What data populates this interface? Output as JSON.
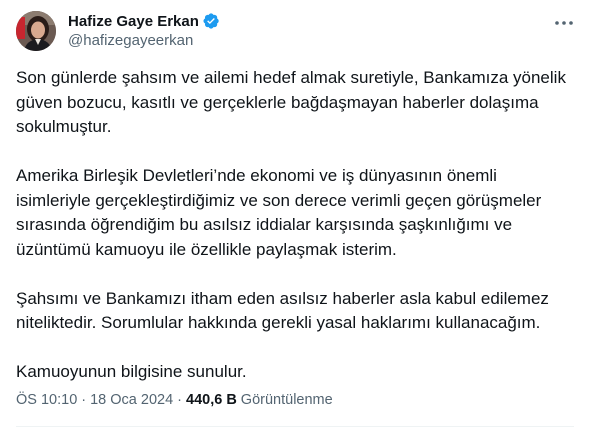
{
  "author": {
    "display_name": "Hafize Gaye Erkan",
    "handle": "@hafizegayeerkan",
    "verified": true,
    "verified_color": "#1d9bf0"
  },
  "post": {
    "paragraphs": [
      "Son günlerde şahsım ve ailemi hedef almak suretiyle, Bankamıza yönelik\ngüven bozucu, kasıtlı ve gerçeklerle bağdaşmayan haberler dolaşıma\nsokulmuştur.",
      "Amerika Birleşik Devletleri’nde ekonomi ve iş dünyasının önemli\nisimleriyle gerçekleştirdiğimiz ve son derece verimli geçen görüşmeler\nsırasında öğrendiğim bu asılsız iddialar karşısında şaşkınlığımı ve\nüzüntümü kamuoyu ile özellikle paylaşmak isterim.",
      "Şahsımı ve Bankamızı itham eden asılsız haberler asla kabul edilemez\nniteliktedir. Sorumlular hakkında gerekli yasal haklarımı kullanacağım.",
      "Kamuoyunun bilgisine sunulur."
    ],
    "time": "ÖS 10:10",
    "separator": "·",
    "date": "18 Oca 2024",
    "views_count": "440,6 B",
    "views_label": "Görüntülenme"
  },
  "icons": {
    "verified": "verified-badge-icon",
    "more": "more-dots-icon"
  },
  "colors": {
    "text_primary": "#0f1419",
    "text_secondary": "#536471",
    "accent": "#1d9bf0"
  }
}
